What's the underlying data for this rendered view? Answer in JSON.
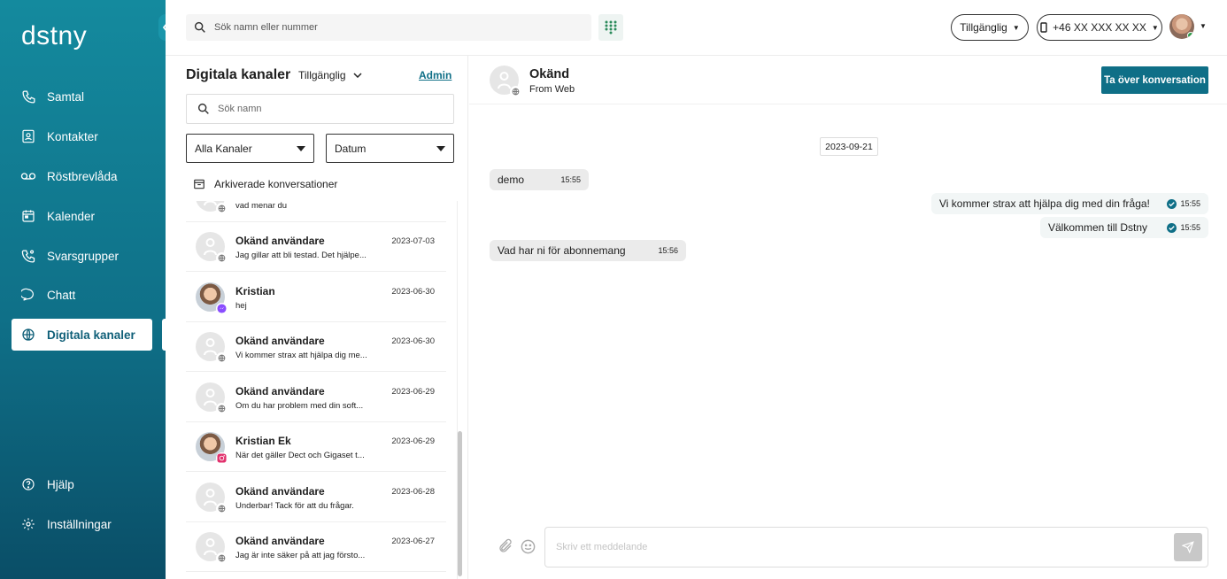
{
  "brand": {
    "logo": "dstny"
  },
  "sidebar": {
    "items": [
      {
        "label": "Samtal",
        "icon": "phone-icon"
      },
      {
        "label": "Kontakter",
        "icon": "contact-card-icon"
      },
      {
        "label": "Röstbrevlåda",
        "icon": "voicemail-icon"
      },
      {
        "label": "Kalender",
        "icon": "calendar-icon"
      },
      {
        "label": "Svarsgrupper",
        "icon": "group-phone-icon"
      },
      {
        "label": "Chatt",
        "icon": "chat-bubble-icon"
      },
      {
        "label": "Digitala kanaler",
        "icon": "globe-icon",
        "active": true
      }
    ],
    "bottom": [
      {
        "label": "Hjälp",
        "icon": "help-icon"
      },
      {
        "label": "Inställningar",
        "icon": "gear-icon"
      }
    ]
  },
  "topbar": {
    "search_placeholder": "Sök namn eller nummer",
    "status": "Tillgänglig",
    "phone": "+46 XX XXX XX XX"
  },
  "panel": {
    "title": "Digitala kanaler",
    "status": "Tillgänglig",
    "admin_link": "Admin",
    "search_placeholder": "Sök namn",
    "channel_filter": "Alla Kanaler",
    "sort_filter": "Datum",
    "archived_label": "Arkiverade konversationer",
    "partial_item": {
      "message": "vad menar du",
      "badge": "web"
    },
    "conversations": [
      {
        "name": "Okänd användare",
        "date": "2023-07-03",
        "message": "Jag gillar att bli testad. Det hjälpe...",
        "badge": "web",
        "photo": false
      },
      {
        "name": "Kristian",
        "date": "2023-06-30",
        "message": "hej",
        "badge": "messenger",
        "photo": true
      },
      {
        "name": "Okänd användare",
        "date": "2023-06-30",
        "message": "Vi kommer strax att hjälpa dig me...",
        "badge": "web",
        "photo": false
      },
      {
        "name": "Okänd användare",
        "date": "2023-06-29",
        "message": "Om du har problem med din soft...",
        "badge": "web",
        "photo": false
      },
      {
        "name": "Kristian Ek",
        "date": "2023-06-29",
        "message": "När det gäller Dect och Gigaset t...",
        "badge": "instagram",
        "photo": true
      },
      {
        "name": "Okänd användare",
        "date": "2023-06-28",
        "message": "Underbar! Tack för att du frågar.",
        "badge": "web",
        "photo": false
      },
      {
        "name": "Okänd användare",
        "date": "2023-06-27",
        "message": "Jag är inte säker på att jag förstо...",
        "badge": "web",
        "photo": false
      }
    ]
  },
  "chat": {
    "contact_name": "Okänd",
    "contact_source": "From Web",
    "takeover_label": "Ta över konversation",
    "date_separator": "2023-09-21",
    "messages": [
      {
        "direction": "in",
        "text": "demo",
        "time": "15:55"
      },
      {
        "direction": "out",
        "text": "Vi kommer strax att hjälpa dig med din fråga!",
        "time": "15:55"
      },
      {
        "direction": "out",
        "text": "Välkommen till Dstny",
        "time": "15:55"
      },
      {
        "direction": "in",
        "text": "Vad har ni för abonnemang",
        "time": "15:56"
      }
    ],
    "composer_placeholder": "Skriv ett meddelande"
  },
  "colors": {
    "brand_teal": "#0f6f87",
    "sidebar_top": "#148a9e",
    "sidebar_bottom": "#0a4e67"
  }
}
